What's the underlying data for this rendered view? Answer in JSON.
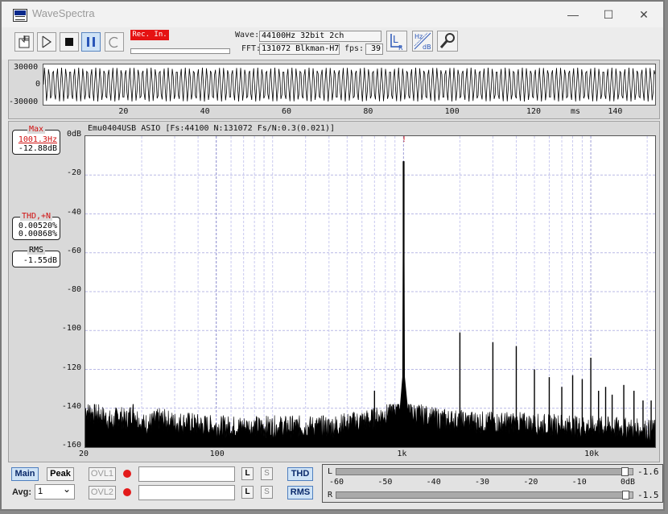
{
  "window": {
    "title": "WaveSpectra",
    "icons": {
      "app": "wavespectra-app-icon",
      "minimize": "minimize-icon",
      "maximize": "maximize-icon",
      "close": "close-icon"
    },
    "minimize_glyph": "—",
    "maximize_glyph": "☐",
    "close_glyph": "✕"
  },
  "toolbar": {
    "rec_label": "Rec. In.",
    "wave_label": "Wave:",
    "wave_value": "44100Hz 32bit 2ch",
    "fft_label": "FFT:",
    "fft_value": "131072 Blkman-H7",
    "fps_label": "fps:",
    "fps_value": "39",
    "buttons": [
      "open-file-icon",
      "play-icon",
      "stop-icon",
      "pause-icon",
      "loop-icon"
    ],
    "tools": [
      "lr-channel-icon",
      "hz-db-icon",
      "wrench-icon"
    ],
    "lr_glyph": "L",
    "lr_sub": "R",
    "hz_glyph": "Hz",
    "db_glyph": "dB"
  },
  "waveform": {
    "y_ticks": [
      "30000",
      "0",
      "-30000"
    ],
    "x_ticks": [
      "20",
      "40",
      "60",
      "80",
      "100",
      "120",
      "140"
    ],
    "x_unit": "ms"
  },
  "spectrum": {
    "header": "Emu0404USB ASIO   [Fs:44100 N:131072 Fs/N:0.3(0.021)]",
    "marker": "!",
    "max_title": "Max",
    "max_freq": "1001.3Hz",
    "max_level": "-12.88dB",
    "thd_title": "THD,+N",
    "thd_value": "0.00520%",
    "thdn_value": "0.00868%",
    "rms_title": "RMS",
    "rms_value": "-1.55dB",
    "y_ticks": [
      "0dB",
      "-20",
      "-40",
      "-60",
      "-80",
      "-100",
      "-120",
      "-140",
      "-160"
    ],
    "x_ticks": [
      "20",
      "100",
      "1k",
      "10k"
    ]
  },
  "chart_data": {
    "type": "line",
    "title": "",
    "xlabel": "",
    "ylabel": "",
    "x_scale": "log",
    "xlim": [
      20,
      22050
    ],
    "ylim": [
      -160,
      0
    ],
    "grid": true,
    "series": [
      {
        "x": [
          20,
          22,
          24,
          26,
          28,
          30,
          33,
          36,
          40,
          45,
          50,
          60,
          70,
          80,
          100,
          200,
          400,
          700,
          900,
          980,
          1001.3,
          1020,
          1100,
          1500,
          2000,
          3000,
          4000,
          5000,
          6000,
          7000,
          8000,
          9000,
          10000,
          15000,
          20000
        ],
        "y": [
          -143,
          -145,
          -146,
          -148,
          -150,
          -146,
          -149,
          -144,
          -151,
          -150,
          -148,
          -150,
          -150,
          -151,
          -152,
          -152,
          -152,
          -148,
          -143,
          -130,
          -12.88,
          -130,
          -145,
          -148,
          -149,
          -150,
          -150,
          -151,
          -151,
          -151,
          -152,
          -152,
          -152,
          -153,
          -154
        ]
      }
    ],
    "harmonics": [
      {
        "x": 2000,
        "y": -101
      },
      {
        "x": 3000,
        "y": -106
      },
      {
        "x": 4000,
        "y": -108
      },
      {
        "x": 5000,
        "y": -120
      },
      {
        "x": 6000,
        "y": -124
      },
      {
        "x": 7000,
        "y": -129
      },
      {
        "x": 8000,
        "y": -123
      },
      {
        "x": 9000,
        "y": -125
      },
      {
        "x": 10000,
        "y": -114
      },
      {
        "x": 11000,
        "y": -131
      },
      {
        "x": 12000,
        "y": -129
      },
      {
        "x": 13000,
        "y": -133
      },
      {
        "x": 15000,
        "y": -128
      },
      {
        "x": 17000,
        "y": -131
      },
      {
        "x": 19000,
        "y": -136
      },
      {
        "x": 21000,
        "y": -136
      },
      {
        "x": 700,
        "y": -131
      },
      {
        "x": 1300,
        "y": -140
      },
      {
        "x": 1100,
        "y": -140
      }
    ]
  },
  "bottom": {
    "main_label": "Main",
    "peak_label": "Peak",
    "avg_label": "Avg:",
    "avg_value": "1",
    "avg_arrow": "⌄",
    "ovl1_label": "OVL1",
    "ovl2_label": "OVL2",
    "l_label": "L",
    "s_label": "S",
    "thd_label": "THD",
    "rms_label": "RMS",
    "meter_l_label": "L",
    "meter_r_label": "R",
    "meter_l_value": "-1.6",
    "meter_r_value": "-1.5",
    "meter_l_level": 0.973,
    "meter_r_level": 0.975,
    "meter_scale": [
      "-60",
      "-50",
      "-40",
      "-30",
      "-20",
      "-10",
      "0dB"
    ]
  }
}
